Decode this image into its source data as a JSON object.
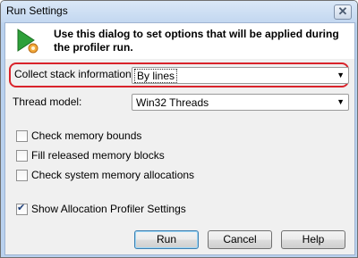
{
  "window": {
    "title": "Run Settings",
    "close_symbol": "✕"
  },
  "header": {
    "text": "Use this dialog to set options that will be applied during the profiler run.",
    "icon": "profiler-run-icon"
  },
  "stack_info": {
    "label": "Collect stack information:",
    "value": "By lines"
  },
  "thread_model": {
    "label": "Thread model:",
    "value": "Win32 Threads"
  },
  "checkboxes": [
    {
      "label": "Check memory bounds",
      "checked": false
    },
    {
      "label": "Fill released memory blocks",
      "checked": false
    },
    {
      "label": "Check system memory allocations",
      "checked": false
    }
  ],
  "show_allocation": {
    "label": "Show Allocation Profiler Settings",
    "checked": true
  },
  "buttons": {
    "run": "Run",
    "cancel": "Cancel",
    "help": "Help"
  },
  "colors": {
    "highlight": "#d9232b",
    "titlebar": "#c3d7f0"
  }
}
